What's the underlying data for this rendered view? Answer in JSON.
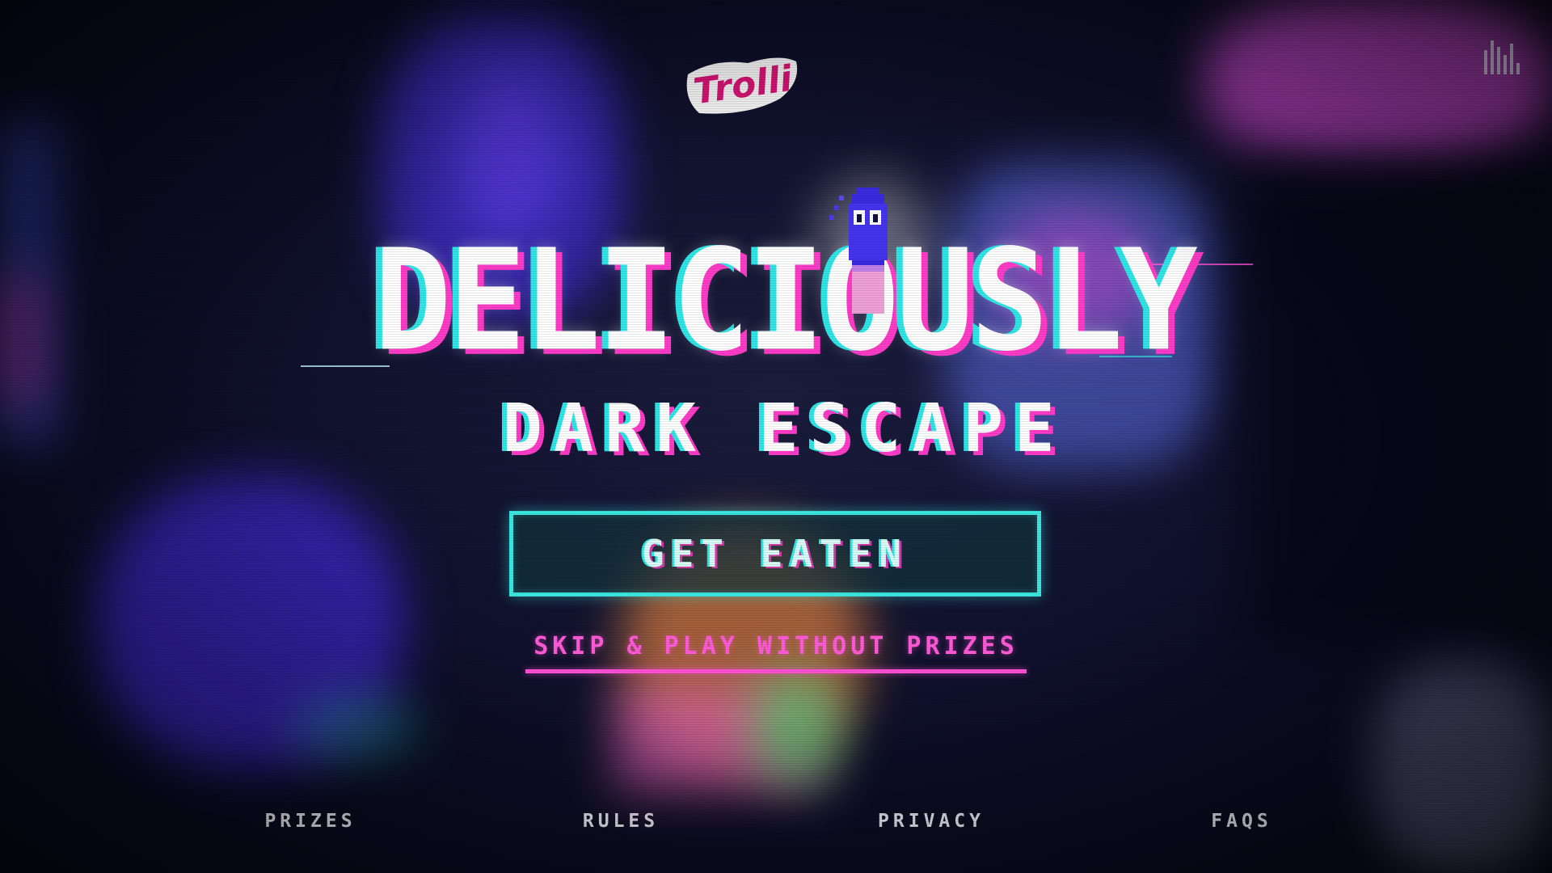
{
  "brand": {
    "logo_text": "Trolli"
  },
  "hero": {
    "title_line1": "DELICIOUSLY",
    "title_line2": "DARK ESCAPE"
  },
  "cta": {
    "label": "GET EATEN"
  },
  "skip_link": {
    "label": "SKIP & PLAY WITHOUT PRIZES"
  },
  "footer": {
    "links": [
      {
        "label": "PRIZES"
      },
      {
        "label": "RULES"
      },
      {
        "label": "PRIVACY"
      },
      {
        "label": "FAQS"
      }
    ]
  },
  "icons": {
    "sound": "sound-bars-icon",
    "mascot": "gummy-worm-mascot"
  },
  "colors": {
    "cyan_accent": "#3be7e0",
    "magenta_accent": "#ff4fd5",
    "background": "#0b0c24",
    "logo_pink": "#e0157a"
  }
}
